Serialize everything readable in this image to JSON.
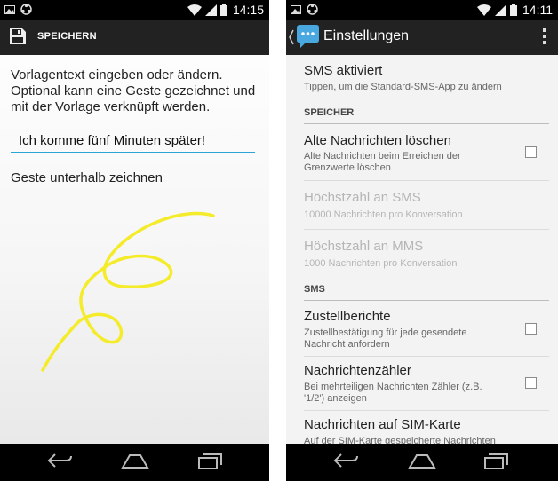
{
  "status_bar": {
    "left_time": "14:15",
    "right_time": "14:11"
  },
  "left_screen": {
    "save_label": "SPEICHERN",
    "instructions": "Vorlagentext eingeben oder ändern. Optional kann eine Geste gezeichnet und mit der Vorlage verknüpft werden.",
    "template_text": "Ich komme fünf Minuten später!",
    "gesture_hint": "Geste unterhalb zeichnen",
    "gesture_color": "#f4ec2a"
  },
  "right_screen": {
    "title": "Einstellungen",
    "accent_color": "#2aa6d6",
    "sms_enabled": {
      "title": "SMS aktiviert",
      "summary": "Tippen, um die Standard-SMS-App zu ändern"
    },
    "category_storage": "SPEICHER",
    "delete_old": {
      "title": "Alte Nachrichten löschen",
      "summary": "Alte Nachrichten beim Erreichen der Grenzwerte löschen",
      "checked": false
    },
    "max_sms": {
      "title": "Höchstzahl an SMS",
      "summary": "10000 Nachrichten pro Konversation",
      "enabled": false
    },
    "max_mms": {
      "title": "Höchstzahl an MMS",
      "summary": "1000 Nachrichten pro Konversation",
      "enabled": false
    },
    "category_sms": "SMS",
    "delivery_reports": {
      "title": "Zustellberichte",
      "summary": "Zustellbestätigung für jede gesendete Nachricht anfordern",
      "checked": false
    },
    "message_counter": {
      "title": "Nachrichtenzähler",
      "summary": "Bei mehrteiligen Nachrichten Zähler (z.B. '1/2') anzeigen",
      "checked": false
    },
    "sim_messages": {
      "title": "Nachrichten auf SIM-Karte",
      "summary": "Auf der SIM-Karte gespeicherte Nachrichten"
    }
  },
  "icons": [
    "picture-icon",
    "ubuntu-icon",
    "wifi-icon",
    "signal-icon",
    "battery-icon",
    "save-icon",
    "back-icon",
    "messaging-app-icon",
    "overflow-menu-icon",
    "nav-back-icon",
    "nav-home-icon",
    "nav-recents-icon"
  ]
}
